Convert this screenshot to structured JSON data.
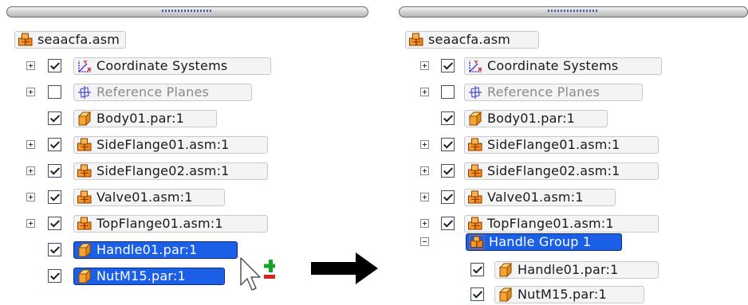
{
  "left": {
    "root": "seaacfa.asm",
    "rows": [
      {
        "label": "Coordinate Systems"
      },
      {
        "label": "Reference Planes"
      },
      {
        "label": "Body01.par:1"
      },
      {
        "label": "SideFlange01.asm:1"
      },
      {
        "label": "SideFlange02.asm:1"
      },
      {
        "label": "Valve01.asm:1"
      },
      {
        "label": "TopFlange01.asm:1"
      },
      {
        "label": "Handle01.par:1"
      },
      {
        "label": "NutM15.par:1"
      }
    ]
  },
  "right": {
    "root": "seaacfa.asm",
    "rows": [
      {
        "label": "Coordinate Systems"
      },
      {
        "label": "Reference Planes"
      },
      {
        "label": "Body01.par:1"
      },
      {
        "label": "SideFlange01.asm:1"
      },
      {
        "label": "SideFlange02.asm:1"
      },
      {
        "label": "Valve01.asm:1"
      },
      {
        "label": "TopFlange01.asm:1"
      },
      {
        "label": "Handle Group 1"
      },
      {
        "label": "Handle01.par:1"
      },
      {
        "label": "NutM15.par:1"
      }
    ]
  },
  "icons": {
    "assembly": "assembly-icon",
    "part": "part-icon",
    "coordinate_system": "coordinate-system-icon",
    "reference_plane": "reference-plane-icon",
    "group": "group-icon",
    "cursor": "add-cursor-icon",
    "arrow": "right-arrow-icon"
  },
  "colors": {
    "selection": "#1a5fe6",
    "assembly_icon": "#f07f14",
    "part_icon": "#f3a23a",
    "add_symbol": "#17a327",
    "remove_symbol": "#d8261d"
  }
}
